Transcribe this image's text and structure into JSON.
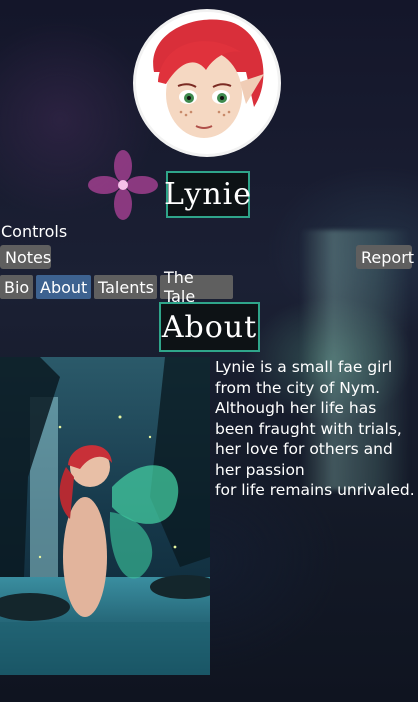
{
  "profile": {
    "name": "Lynie",
    "avatar_icon": "avatar-fae-girl-red-hair"
  },
  "controls": {
    "label": "Controls",
    "notes_label": "Notes",
    "report_label": "Report"
  },
  "tabs": [
    {
      "label": "Bio",
      "active": false
    },
    {
      "label": "About",
      "active": true
    },
    {
      "label": "Talents",
      "active": false
    },
    {
      "label": "The Tale",
      "active": false
    }
  ],
  "section": {
    "title": "About",
    "text_lines": [
      "Lynie is a small fae girl",
      "from the city of Nym.",
      "Although her life has",
      "been fraught with trials,",
      "her love for others and",
      "her passion",
      "for life remains unrivaled."
    ]
  },
  "colors": {
    "accent_border": "#2fa58a",
    "button_bg": "#5f5f5f",
    "active_tab_bg": "#3d6290",
    "hair": "#e0323c"
  }
}
